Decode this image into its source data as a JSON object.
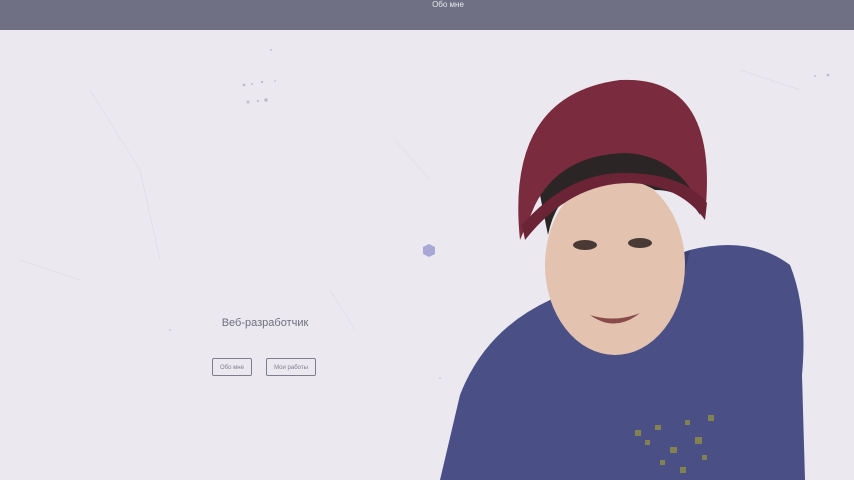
{
  "header": {
    "brand": "",
    "nav": [
      "Обо мне"
    ]
  },
  "hero": {
    "subtitle": "Веб-разработчик",
    "buttons": {
      "about": "Обо мне",
      "works": "Мои работы"
    }
  },
  "colors": {
    "header_bg": "#6f7083",
    "page_bg": "#ebe9ef",
    "accent_dot": "#a8a8d6",
    "hat": "#7a2b3d",
    "shirt": "#4a4f86"
  },
  "icons": [
    "particle-dot-icon"
  ]
}
